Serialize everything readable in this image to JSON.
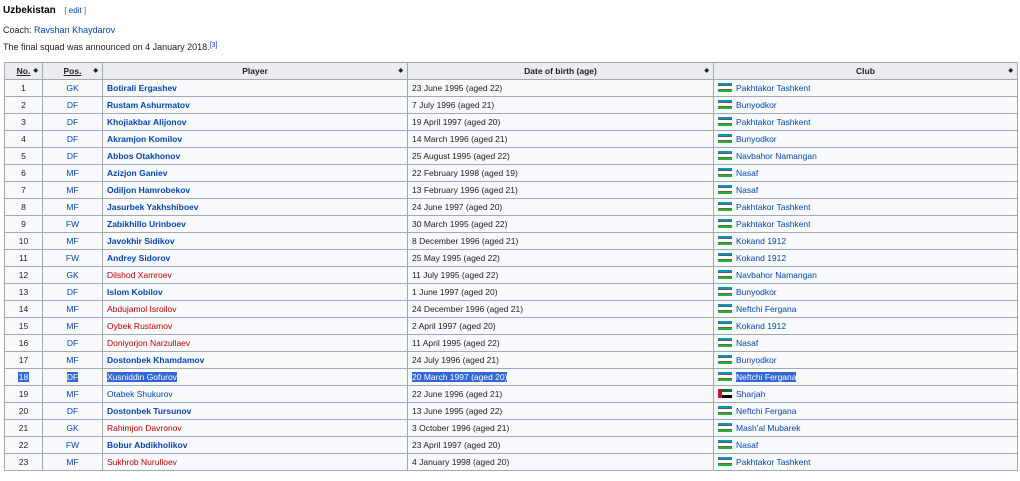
{
  "header": {
    "title": "Uzbekistan",
    "edit_label": "edit",
    "bracket_open": "[",
    "bracket_close": "]"
  },
  "coach": {
    "label": "Coach:",
    "name": "Ravshan Khaydarov"
  },
  "note": {
    "text": "The final squad was announced on 4 January 2018.",
    "ref": "[3]"
  },
  "columns": [
    "No.",
    "Pos.",
    "Player",
    "Date of birth (age)",
    "Club"
  ],
  "colors": {
    "link": "#0645ad",
    "redlink": "#ba0000",
    "header_bg": "#eaecf0",
    "cell_bg": "#f8f9fa",
    "selection": "#3367d6"
  },
  "rows": [
    {
      "no": "1",
      "pos": "GK",
      "player": "Botirali Ergashev",
      "link": "blue",
      "dob": "23 June 1995 (aged 22)",
      "flag": "uz",
      "club": "Pakhtakor Tashkent"
    },
    {
      "no": "2",
      "pos": "DF",
      "player": "Rustam Ashurmatov",
      "link": "blue",
      "dob": "7 July 1996 (aged 21)",
      "flag": "uz",
      "club": "Bunyodkor"
    },
    {
      "no": "3",
      "pos": "DF",
      "player": "Khojiakbar Alijonov",
      "link": "blue",
      "dob": "19 April 1997 (aged 20)",
      "flag": "uz",
      "club": "Pakhtakor Tashkent"
    },
    {
      "no": "4",
      "pos": "DF",
      "player": "Akramjon Komilov",
      "link": "blue",
      "dob": "14 March 1996 (aged 21)",
      "flag": "uz",
      "club": "Bunyodkor"
    },
    {
      "no": "5",
      "pos": "DF",
      "player": "Abbos Otakhonov",
      "link": "blue",
      "dob": "25 August 1995 (aged 22)",
      "flag": "uz",
      "club": "Navbahor Namangan"
    },
    {
      "no": "6",
      "pos": "MF",
      "player": "Azizjon Ganiev",
      "link": "blue",
      "dob": "22 February 1998 (aged 19)",
      "flag": "uz",
      "club": "Nasaf"
    },
    {
      "no": "7",
      "pos": "MF",
      "player": "Odiljon Hamrobekov",
      "link": "blue",
      "dob": "13 February 1996 (aged 21)",
      "flag": "uz",
      "club": "Nasaf"
    },
    {
      "no": "8",
      "pos": "MF",
      "player": "Jasurbek Yakhshiboev",
      "link": "blue",
      "dob": "24 June 1997 (aged 20)",
      "flag": "uz",
      "club": "Pakhtakor Tashkent"
    },
    {
      "no": "9",
      "pos": "FW",
      "player": "Zabikhillo Urinboev",
      "link": "blue",
      "dob": "30 March 1995 (aged 22)",
      "flag": "uz",
      "club": "Pakhtakor Tashkent"
    },
    {
      "no": "10",
      "pos": "MF",
      "player": "Javokhir Sidikov",
      "link": "blue",
      "dob": "8 December 1996 (aged 21)",
      "flag": "uz",
      "club": "Kokand 1912"
    },
    {
      "no": "11",
      "pos": "FW",
      "player": "Andrey Sidorov",
      "link": "blue",
      "dob": "25 May 1995 (aged 22)",
      "flag": "uz",
      "club": "Kokand 1912"
    },
    {
      "no": "12",
      "pos": "GK",
      "player": "Dilshod Xamroev",
      "link": "red",
      "dob": "11 July 1995 (aged 22)",
      "flag": "uz",
      "club": "Navbahor Namangan"
    },
    {
      "no": "13",
      "pos": "DF",
      "player": "Islom Kobilov",
      "link": "blue",
      "dob": "1 June 1997 (aged 20)",
      "flag": "uz",
      "club": "Bunyodkor"
    },
    {
      "no": "14",
      "pos": "MF",
      "player": "Abdujamol Isroilov",
      "link": "red",
      "dob": "24 December 1996 (aged 21)",
      "flag": "uz",
      "club": "Neftchi Fergana"
    },
    {
      "no": "15",
      "pos": "MF",
      "player": "Oybek Rustamov",
      "link": "red",
      "dob": "2 April 1997 (aged 20)",
      "flag": "uz",
      "club": "Kokand 1912"
    },
    {
      "no": "16",
      "pos": "DF",
      "player": "Doniyorjon Narzullaev",
      "link": "red",
      "dob": "11 April 1995 (aged 22)",
      "flag": "uz",
      "club": "Nasaf"
    },
    {
      "no": "17",
      "pos": "MF",
      "player": "Dostonbek Khamdamov",
      "link": "blue",
      "dob": "24 July 1996 (aged 21)",
      "flag": "uz",
      "club": "Bunyodkor"
    },
    {
      "no": "18",
      "pos": "DF",
      "player": "Xusniddin Gofurov",
      "link": "red",
      "dob": "20 March 1997 (aged 20)",
      "flag": "uz",
      "club": "Neftchi Fergana",
      "selected": true
    },
    {
      "no": "19",
      "pos": "MF",
      "player": "Otabek Shukurov",
      "link": "plain",
      "dob": "22 June 1996 (aged 21)",
      "flag": "ae",
      "club": "Sharjah"
    },
    {
      "no": "20",
      "pos": "DF",
      "player": "Dostonbek Tursunov",
      "link": "blue",
      "dob": "13 June 1995 (aged 22)",
      "flag": "uz",
      "club": "Neftchi Fergana"
    },
    {
      "no": "21",
      "pos": "GK",
      "player": "Rahimjon Davronov",
      "link": "red",
      "dob": "3 October 1996 (aged 21)",
      "flag": "uz",
      "club": "Mash'al Mubarek"
    },
    {
      "no": "22",
      "pos": "FW",
      "player": "Bobur Abdikholikov",
      "link": "blue",
      "dob": "23 April 1997 (aged 20)",
      "flag": "uz",
      "club": "Nasaf"
    },
    {
      "no": "23",
      "pos": "MF",
      "player": "Sukhrob Nurulloev",
      "link": "red",
      "dob": "4 January 1998 (aged 20)",
      "flag": "uz",
      "club": "Pakhtakor Tashkent"
    }
  ]
}
